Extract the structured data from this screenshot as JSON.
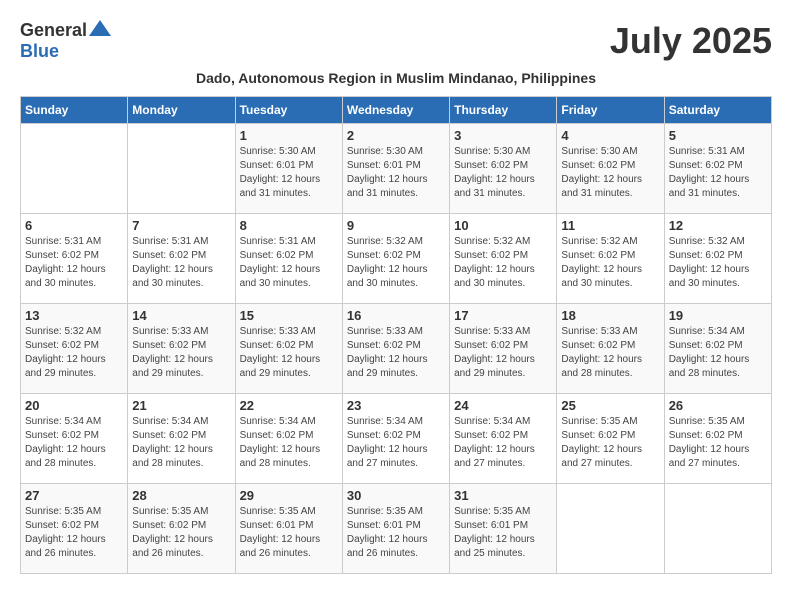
{
  "header": {
    "logo_general": "General",
    "logo_blue": "Blue",
    "month_title": "July 2025",
    "subtitle": "Dado, Autonomous Region in Muslim Mindanao, Philippines"
  },
  "calendar": {
    "weekdays": [
      "Sunday",
      "Monday",
      "Tuesday",
      "Wednesday",
      "Thursday",
      "Friday",
      "Saturday"
    ],
    "weeks": [
      [
        {
          "day": "",
          "info": ""
        },
        {
          "day": "",
          "info": ""
        },
        {
          "day": "1",
          "info": "Sunrise: 5:30 AM\nSunset: 6:01 PM\nDaylight: 12 hours and 31 minutes."
        },
        {
          "day": "2",
          "info": "Sunrise: 5:30 AM\nSunset: 6:01 PM\nDaylight: 12 hours and 31 minutes."
        },
        {
          "day": "3",
          "info": "Sunrise: 5:30 AM\nSunset: 6:02 PM\nDaylight: 12 hours and 31 minutes."
        },
        {
          "day": "4",
          "info": "Sunrise: 5:30 AM\nSunset: 6:02 PM\nDaylight: 12 hours and 31 minutes."
        },
        {
          "day": "5",
          "info": "Sunrise: 5:31 AM\nSunset: 6:02 PM\nDaylight: 12 hours and 31 minutes."
        }
      ],
      [
        {
          "day": "6",
          "info": "Sunrise: 5:31 AM\nSunset: 6:02 PM\nDaylight: 12 hours and 30 minutes."
        },
        {
          "day": "7",
          "info": "Sunrise: 5:31 AM\nSunset: 6:02 PM\nDaylight: 12 hours and 30 minutes."
        },
        {
          "day": "8",
          "info": "Sunrise: 5:31 AM\nSunset: 6:02 PM\nDaylight: 12 hours and 30 minutes."
        },
        {
          "day": "9",
          "info": "Sunrise: 5:32 AM\nSunset: 6:02 PM\nDaylight: 12 hours and 30 minutes."
        },
        {
          "day": "10",
          "info": "Sunrise: 5:32 AM\nSunset: 6:02 PM\nDaylight: 12 hours and 30 minutes."
        },
        {
          "day": "11",
          "info": "Sunrise: 5:32 AM\nSunset: 6:02 PM\nDaylight: 12 hours and 30 minutes."
        },
        {
          "day": "12",
          "info": "Sunrise: 5:32 AM\nSunset: 6:02 PM\nDaylight: 12 hours and 30 minutes."
        }
      ],
      [
        {
          "day": "13",
          "info": "Sunrise: 5:32 AM\nSunset: 6:02 PM\nDaylight: 12 hours and 29 minutes."
        },
        {
          "day": "14",
          "info": "Sunrise: 5:33 AM\nSunset: 6:02 PM\nDaylight: 12 hours and 29 minutes."
        },
        {
          "day": "15",
          "info": "Sunrise: 5:33 AM\nSunset: 6:02 PM\nDaylight: 12 hours and 29 minutes."
        },
        {
          "day": "16",
          "info": "Sunrise: 5:33 AM\nSunset: 6:02 PM\nDaylight: 12 hours and 29 minutes."
        },
        {
          "day": "17",
          "info": "Sunrise: 5:33 AM\nSunset: 6:02 PM\nDaylight: 12 hours and 29 minutes."
        },
        {
          "day": "18",
          "info": "Sunrise: 5:33 AM\nSunset: 6:02 PM\nDaylight: 12 hours and 28 minutes."
        },
        {
          "day": "19",
          "info": "Sunrise: 5:34 AM\nSunset: 6:02 PM\nDaylight: 12 hours and 28 minutes."
        }
      ],
      [
        {
          "day": "20",
          "info": "Sunrise: 5:34 AM\nSunset: 6:02 PM\nDaylight: 12 hours and 28 minutes."
        },
        {
          "day": "21",
          "info": "Sunrise: 5:34 AM\nSunset: 6:02 PM\nDaylight: 12 hours and 28 minutes."
        },
        {
          "day": "22",
          "info": "Sunrise: 5:34 AM\nSunset: 6:02 PM\nDaylight: 12 hours and 28 minutes."
        },
        {
          "day": "23",
          "info": "Sunrise: 5:34 AM\nSunset: 6:02 PM\nDaylight: 12 hours and 27 minutes."
        },
        {
          "day": "24",
          "info": "Sunrise: 5:34 AM\nSunset: 6:02 PM\nDaylight: 12 hours and 27 minutes."
        },
        {
          "day": "25",
          "info": "Sunrise: 5:35 AM\nSunset: 6:02 PM\nDaylight: 12 hours and 27 minutes."
        },
        {
          "day": "26",
          "info": "Sunrise: 5:35 AM\nSunset: 6:02 PM\nDaylight: 12 hours and 27 minutes."
        }
      ],
      [
        {
          "day": "27",
          "info": "Sunrise: 5:35 AM\nSunset: 6:02 PM\nDaylight: 12 hours and 26 minutes."
        },
        {
          "day": "28",
          "info": "Sunrise: 5:35 AM\nSunset: 6:02 PM\nDaylight: 12 hours and 26 minutes."
        },
        {
          "day": "29",
          "info": "Sunrise: 5:35 AM\nSunset: 6:01 PM\nDaylight: 12 hours and 26 minutes."
        },
        {
          "day": "30",
          "info": "Sunrise: 5:35 AM\nSunset: 6:01 PM\nDaylight: 12 hours and 26 minutes."
        },
        {
          "day": "31",
          "info": "Sunrise: 5:35 AM\nSunset: 6:01 PM\nDaylight: 12 hours and 25 minutes."
        },
        {
          "day": "",
          "info": ""
        },
        {
          "day": "",
          "info": ""
        }
      ]
    ]
  }
}
